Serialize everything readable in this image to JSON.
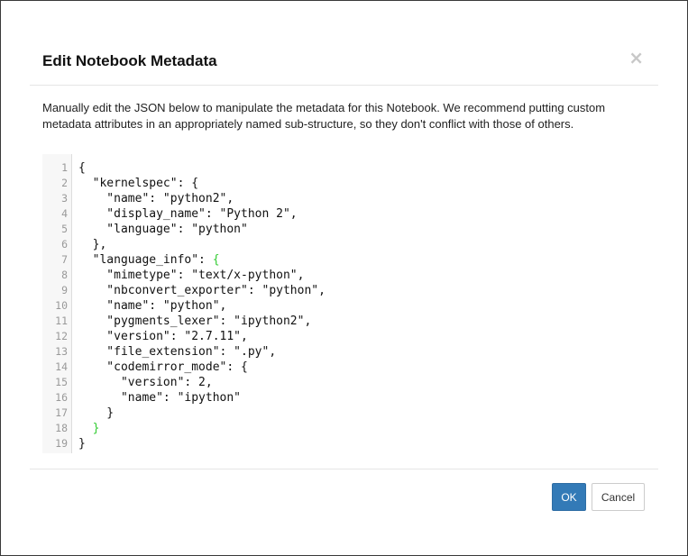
{
  "dialog": {
    "title": "Edit Notebook Metadata",
    "close_label": "×",
    "description": "Manually edit the JSON below to manipulate the metadata for this Notebook. We recommend putting custom metadata attributes in an appropriately named sub-structure, so they don't conflict with those of others."
  },
  "editor": {
    "line_numbers": [
      "1",
      "2",
      "3",
      "4",
      "5",
      "6",
      "7",
      "8",
      "9",
      "10",
      "11",
      "12",
      "13",
      "14",
      "15",
      "16",
      "17",
      "18",
      "19"
    ],
    "lines": [
      {
        "text": "{"
      },
      {
        "text": "  \"kernelspec\": {"
      },
      {
        "text": "    \"name\": \"python2\","
      },
      {
        "text": "    \"display_name\": \"Python 2\","
      },
      {
        "text": "    \"language\": \"python\""
      },
      {
        "text": "  },"
      },
      {
        "text": "  \"language_info\": ",
        "highlight": "{"
      },
      {
        "text": "    \"mimetype\": \"text/x-python\","
      },
      {
        "text": "    \"nbconvert_exporter\": \"python\","
      },
      {
        "text": "    \"name\": \"python\","
      },
      {
        "text": "    \"pygments_lexer\": \"ipython2\","
      },
      {
        "text": "    \"version\": \"2.7.11\","
      },
      {
        "text": "    \"file_extension\": \".py\","
      },
      {
        "text": "    \"codemirror_mode\": {"
      },
      {
        "text": "      \"version\": 2,"
      },
      {
        "text": "      \"name\": \"ipython\""
      },
      {
        "text": "    }"
      },
      {
        "text": "  ",
        "highlight": "}"
      },
      {
        "text": "}"
      }
    ],
    "highlight_color": "#33cc33"
  },
  "footer": {
    "ok_label": "OK",
    "cancel_label": "Cancel"
  },
  "colors": {
    "primary_button": "#337ab7"
  }
}
